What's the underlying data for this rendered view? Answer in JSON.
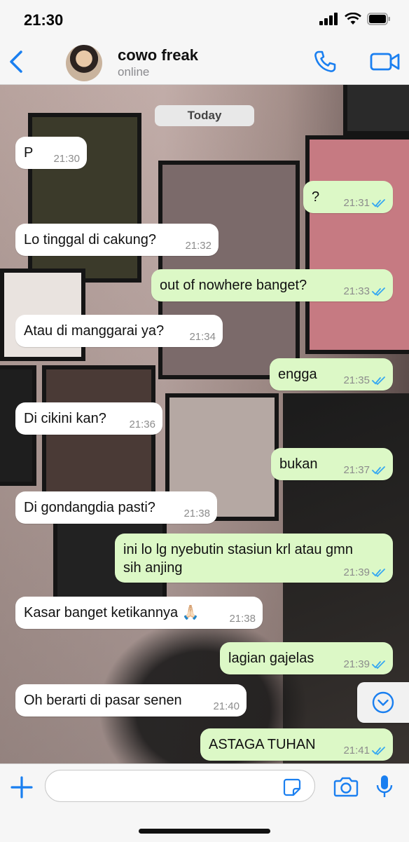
{
  "status_bar": {
    "time": "21:30"
  },
  "header": {
    "contact_name": "cowo freak",
    "contact_status": "online"
  },
  "chat": {
    "date_label": "Today",
    "messages": [
      {
        "dir": "in",
        "text": "P",
        "time": "21:30"
      },
      {
        "dir": "out",
        "text": "?",
        "time": "21:31",
        "read": true
      },
      {
        "dir": "in",
        "text": "Lo tinggal di cakung?",
        "time": "21:32"
      },
      {
        "dir": "out",
        "text": "out of nowhere banget?",
        "time": "21:33",
        "read": true
      },
      {
        "dir": "in",
        "text": "Atau di manggarai ya?",
        "time": "21:34"
      },
      {
        "dir": "out",
        "text": "engga",
        "time": "21:35",
        "read": true
      },
      {
        "dir": "in",
        "text": "Di cikini kan?",
        "time": "21:36"
      },
      {
        "dir": "out",
        "text": "bukan",
        "time": "21:37",
        "read": true
      },
      {
        "dir": "in",
        "text": "Di gondangdia pasti?",
        "time": "21:38"
      },
      {
        "dir": "out",
        "text": "ini lo lg nyebutin stasiun krl atau gmn\nsih anjing",
        "time": "21:39",
        "read": true
      },
      {
        "dir": "in",
        "text": "Kasar banget ketikannya 🙏🏻",
        "time": "21:38"
      },
      {
        "dir": "out",
        "text": "lagian gajelas",
        "time": "21:39",
        "read": true
      },
      {
        "dir": "in",
        "text": "Oh berarti di pasar senen",
        "time": "21:40"
      },
      {
        "dir": "out",
        "text": "ASTAGA TUHAN",
        "time": "21:41",
        "read": true
      }
    ]
  },
  "input_bar": {
    "placeholder": ""
  },
  "icons": {
    "back": "chevron-left-icon",
    "call": "phone-icon",
    "video": "video-camera-icon",
    "plus": "plus-icon",
    "sticker": "sticker-icon",
    "camera": "camera-icon",
    "mic": "microphone-icon",
    "scroll": "chevron-down-circle-icon"
  },
  "colors": {
    "accent": "#1a7ff0",
    "incoming": "#ffffff",
    "outgoing": "#dcf8c6",
    "read_ticks": "#34a7f2"
  }
}
